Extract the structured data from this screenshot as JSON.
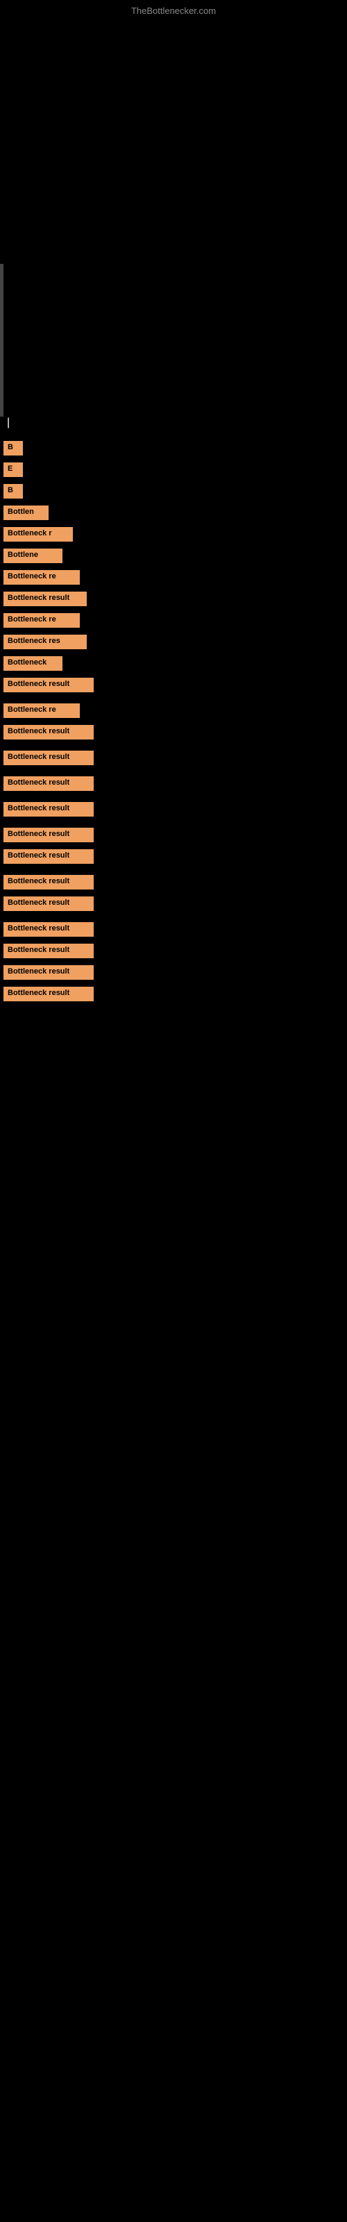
{
  "site": {
    "title": "TheBottlenecker.com"
  },
  "labels": {
    "vertical_bar_label": "|",
    "section_label": "Bottleneck result"
  },
  "bottleneck_items": [
    {
      "id": 1,
      "label": "B",
      "width_class": "bw-xs",
      "extra_space": false
    },
    {
      "id": 2,
      "label": "E",
      "width_class": "bw-xs",
      "extra_space": false
    },
    {
      "id": 3,
      "label": "B",
      "width_class": "bw-xs",
      "extra_space": false
    },
    {
      "id": 4,
      "label": "Bottlen",
      "width_class": "bw-sm",
      "extra_space": false
    },
    {
      "id": 5,
      "label": "Bottleneck r",
      "width_class": "bw-ml",
      "extra_space": false
    },
    {
      "id": 6,
      "label": "Bottlene",
      "width_class": "bw-m",
      "extra_space": false
    },
    {
      "id": 7,
      "label": "Bottleneck re",
      "width_class": "bw-l",
      "extra_space": false
    },
    {
      "id": 8,
      "label": "Bottleneck result",
      "width_class": "bw-xl",
      "extra_space": false
    },
    {
      "id": 9,
      "label": "Bottleneck re",
      "width_class": "bw-l",
      "extra_space": false
    },
    {
      "id": 10,
      "label": "Bottleneck res",
      "width_class": "bw-xl",
      "extra_space": false
    },
    {
      "id": 11,
      "label": "Bottleneck",
      "width_class": "bw-m",
      "extra_space": false
    },
    {
      "id": 12,
      "label": "Bottleneck result",
      "width_class": "bw-xxl",
      "extra_space": true
    },
    {
      "id": 13,
      "label": "Bottleneck re",
      "width_class": "bw-l",
      "extra_space": false
    },
    {
      "id": 14,
      "label": "Bottleneck result",
      "width_class": "bw-xxl",
      "extra_space": true
    },
    {
      "id": 15,
      "label": "Bottleneck result",
      "width_class": "bw-xxl",
      "extra_space": true
    },
    {
      "id": 16,
      "label": "Bottleneck result",
      "width_class": "bw-xxl",
      "extra_space": true
    },
    {
      "id": 17,
      "label": "Bottleneck result",
      "width_class": "bw-xxl",
      "extra_space": true
    },
    {
      "id": 18,
      "label": "Bottleneck result",
      "width_class": "bw-xxl",
      "extra_space": false
    },
    {
      "id": 19,
      "label": "Bottleneck result",
      "width_class": "bw-xxl",
      "extra_space": true
    },
    {
      "id": 20,
      "label": "Bottleneck result",
      "width_class": "bw-xxl",
      "extra_space": false
    },
    {
      "id": 21,
      "label": "Bottleneck result",
      "width_class": "bw-xxl",
      "extra_space": true
    },
    {
      "id": 22,
      "label": "Bottleneck result",
      "width_class": "bw-xxl",
      "extra_space": false
    },
    {
      "id": 23,
      "label": "Bottleneck result",
      "width_class": "bw-xxl",
      "extra_space": false
    },
    {
      "id": 24,
      "label": "Bottleneck result",
      "width_class": "bw-xxl",
      "extra_space": false
    },
    {
      "id": 25,
      "label": "Bottleneck result",
      "width_class": "bw-xxl",
      "extra_space": false
    }
  ]
}
